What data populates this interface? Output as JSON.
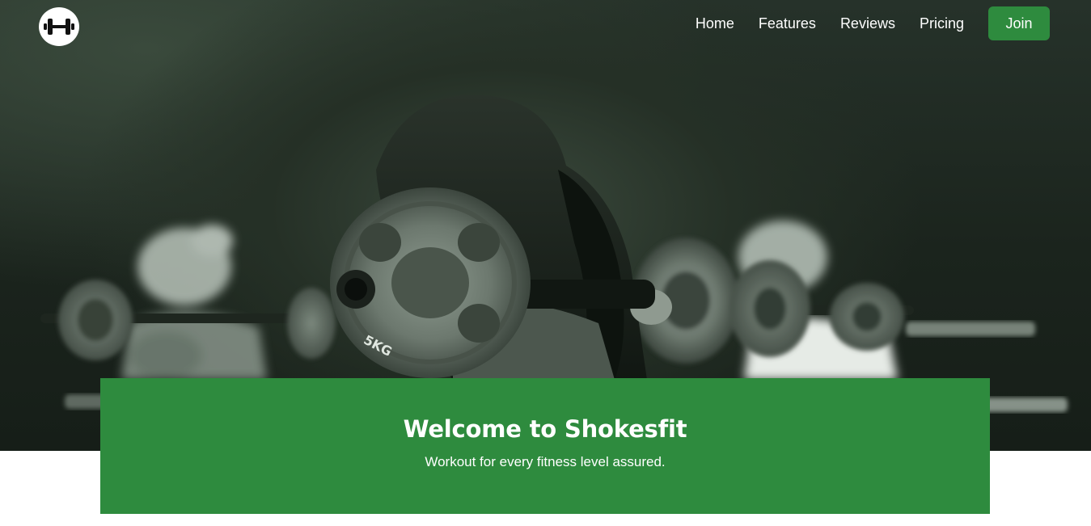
{
  "brand": {
    "logo_icon": "dumbbell-icon"
  },
  "nav": {
    "items": [
      {
        "label": "Home"
      },
      {
        "label": "Features"
      },
      {
        "label": "Reviews"
      },
      {
        "label": "Pricing"
      }
    ],
    "join_label": "Join"
  },
  "hero": {
    "title": "Welcome to Shokesfit",
    "subtitle": "Workout for every fitness level assured.",
    "plate_label": "5KG"
  },
  "colors": {
    "accent": "#2e8b3e",
    "hero_tint": "#1b241d",
    "text_light": "#ffffff"
  }
}
